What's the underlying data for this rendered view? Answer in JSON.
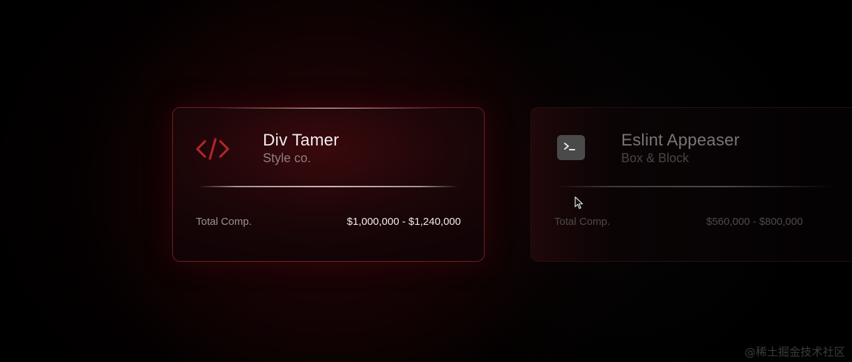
{
  "cards": [
    {
      "icon": "code-brackets-icon",
      "title": "Div Tamer",
      "company": "Style co.",
      "comp_label": "Total Comp.",
      "comp_range": "$1,000,000 - $1,240,000",
      "state": "active"
    },
    {
      "icon": "terminal-icon",
      "title": "Eslint Appeaser",
      "company": "Box & Block",
      "comp_label": "Total Comp.",
      "comp_range": "$560,000 - $800,000",
      "state": "inactive"
    }
  ],
  "watermark": "@稀土掘金技术社区",
  "colors": {
    "accent_red": "#b0252a",
    "background": "#000000",
    "card_border_active": "#96282c",
    "icon_gray": "#4a4a4a"
  }
}
